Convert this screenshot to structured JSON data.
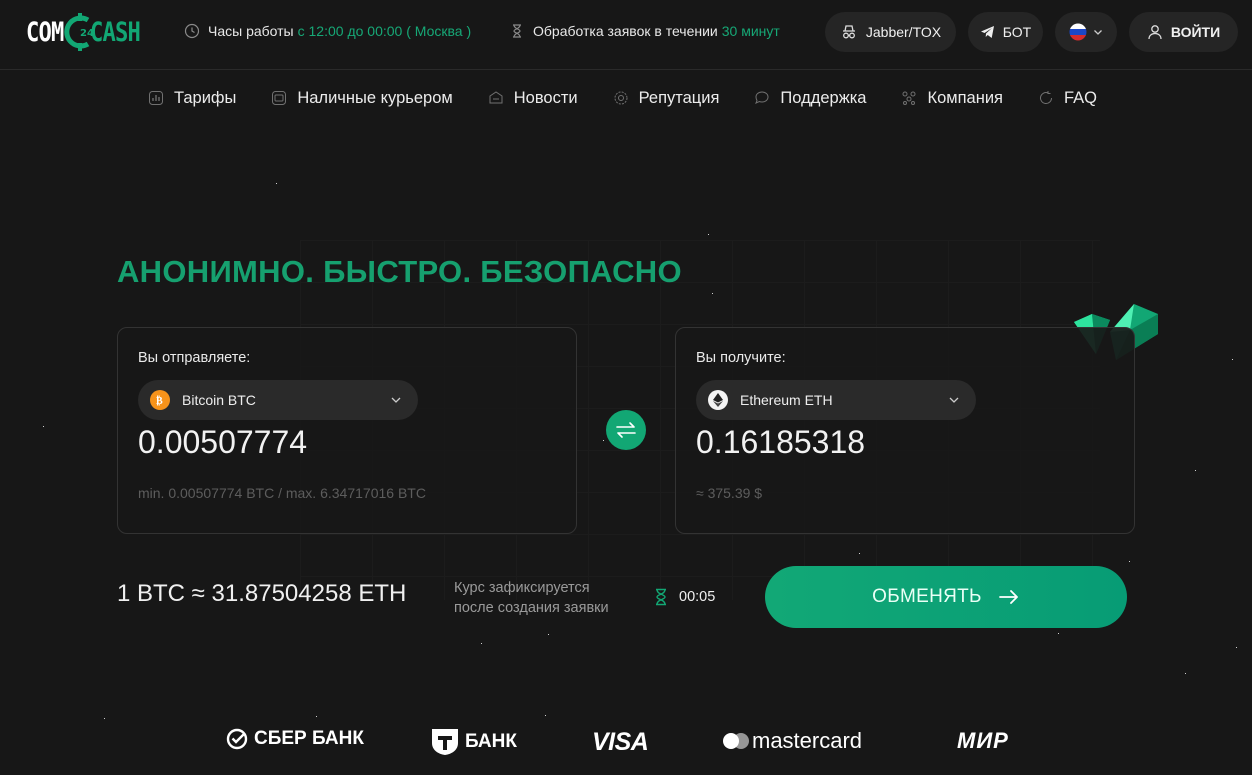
{
  "brand": {
    "part1": "COM",
    "part2": "CASH",
    "mark": "24"
  },
  "header": {
    "hours_label": "Часы работы",
    "hours_value": "с 12:00 до 00:00 ( Москва )",
    "processing_label": "Обработка заявок в течении",
    "processing_value": "30 минут",
    "jabber_label": "Jabber/TOX",
    "bot_label": "БОТ",
    "login_label": "ВОЙТИ"
  },
  "nav": [
    {
      "label": "Тарифы",
      "icon": "chart-icon"
    },
    {
      "label": "Наличные курьером",
      "icon": "wallet-icon"
    },
    {
      "label": "Новости",
      "icon": "news-icon"
    },
    {
      "label": "Репутация",
      "icon": "gear-icon"
    },
    {
      "label": "Поддержка",
      "icon": "chat-icon"
    },
    {
      "label": "Компания",
      "icon": "team-icon"
    },
    {
      "label": "FAQ",
      "icon": "refresh-icon"
    }
  ],
  "hero": {
    "headline": "АНОНИМНО. БЫСТРО. БЕЗОПАСНО"
  },
  "send": {
    "label": "Вы отправляете:",
    "currency": "Bitcoin BTC",
    "amount": "0.00507774",
    "limits": "min. 0.00507774 BTC / max. 6.34717016 BTC"
  },
  "receive": {
    "label": "Вы получите:",
    "currency": "Ethereum ETH",
    "amount": "0.16185318",
    "usd": "≈ 375.39 $"
  },
  "rate": {
    "value": "1 BTC ≈ 31.87504258 ETH",
    "note_line1": "Курс зафиксируется",
    "note_line2": "после создания заявки",
    "timer": "00:05"
  },
  "exchange_button": "ОБМЕНЯТЬ",
  "payments": {
    "sber": "СБЕР БАНК",
    "tbank": "БАНК",
    "visa": "VISA",
    "mastercard": "mastercard",
    "mir": "МИР"
  },
  "colors": {
    "accent": "#12a774",
    "background": "#171717",
    "card": "#181818",
    "btc": "#f7931a"
  }
}
